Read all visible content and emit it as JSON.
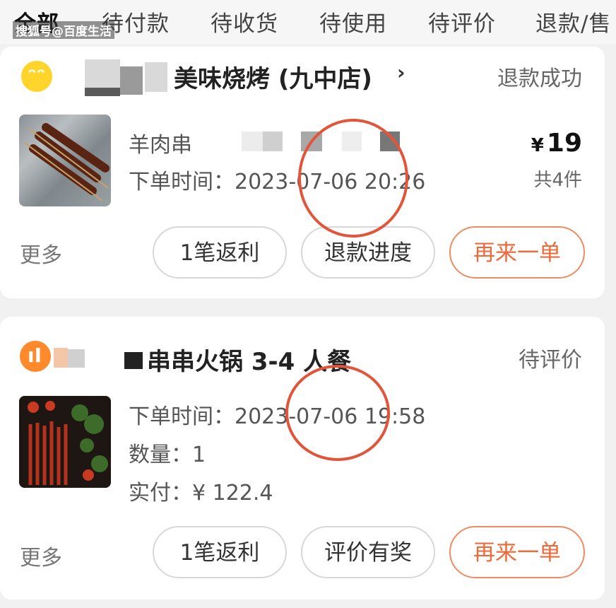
{
  "tabs": [
    "全部",
    "待付款",
    "待收货",
    "待使用",
    "待评价",
    "退款/售"
  ],
  "watermark": "搜狐号@百度生活",
  "orders": [
    {
      "shop_name": "美味烧烤 (九中店)",
      "status": "退款成功",
      "item_name": "羊肉串",
      "order_time": "下单时间：2023-07-06 20:26",
      "price_symbol": "¥",
      "price": "19",
      "count": "共4件",
      "more": "更多",
      "buttons": [
        "1笔返利",
        "退款进度",
        "再来一单"
      ]
    },
    {
      "shop_name": "串串火锅 3-4 人餐",
      "status": "待评价",
      "order_time": "下单时间：2023-07-06 19:58",
      "quantity": "数量：1",
      "paid": "实付：¥ 122.4",
      "more": "更多",
      "buttons": [
        "1笔返利",
        "评价有奖",
        "再来一单"
      ]
    }
  ],
  "colors": {
    "accent": "#ee6a3a",
    "annotation_circle": "#e2553a"
  },
  "icons": {
    "shop1": "rabbit-logo-icon",
    "shop2": "fork-knife-icon",
    "chevron": "chevron-right-icon"
  }
}
